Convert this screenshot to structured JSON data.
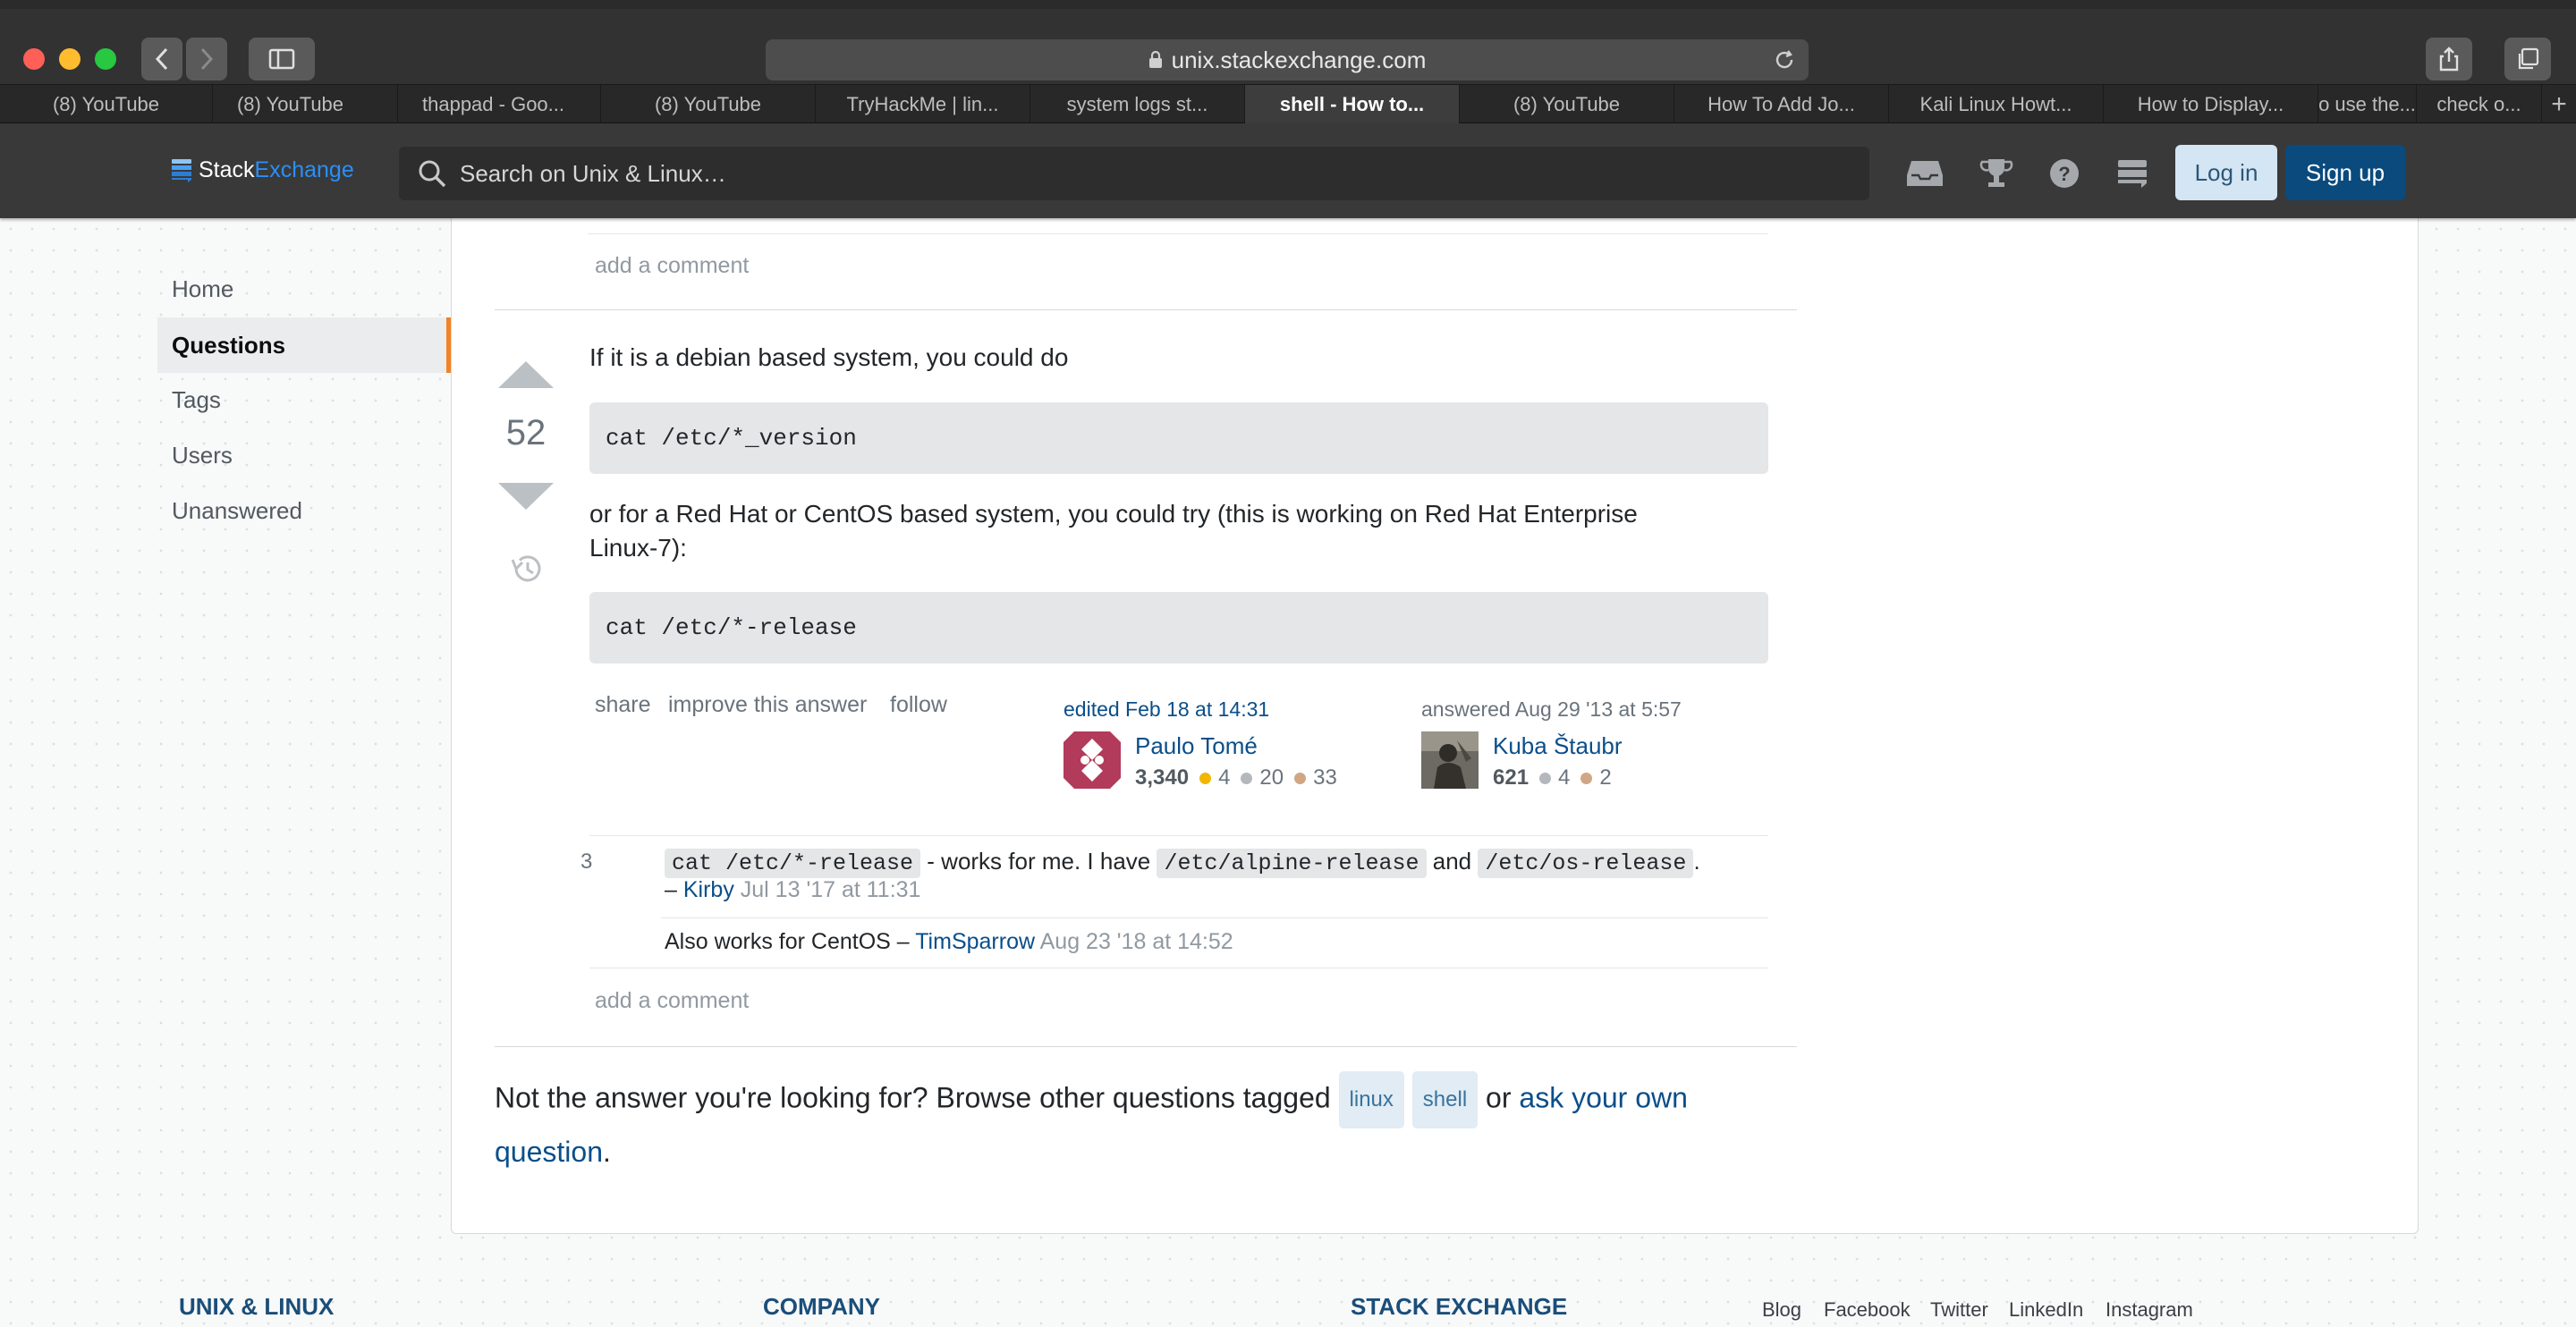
{
  "browser": {
    "url": "unix.stackexchange.com",
    "tabs": [
      "(8) YouTube",
      "(8) YouTube",
      "thappad - Goo...",
      "(8) YouTube",
      "TryHackMe | lin...",
      "system logs st...",
      "shell - How to...",
      "(8) YouTube",
      "How To Add Jo...",
      "Kali Linux Howt...",
      "How to Display...",
      "o use the...",
      "check o..."
    ],
    "active_tab_index": 6,
    "new_tab": "+"
  },
  "header": {
    "logo_stack": "Stack",
    "logo_exchange": "Exchange",
    "search_placeholder": "Search on Unix & Linux…",
    "login": "Log in",
    "signup": "Sign up"
  },
  "sidebar": {
    "items": [
      "Home",
      "Questions",
      "Tags",
      "Users",
      "Unanswered"
    ],
    "selected": "Questions"
  },
  "prev_answer": {
    "add_comment": "add a comment"
  },
  "answer": {
    "votes": "52",
    "intro": "If it is a debian based system, you could do",
    "code1": "cat /etc/*_version",
    "middle_line1": "or for a Red Hat or CentOS based system, you could try (this is working on Red Hat Enterprise",
    "middle_line2": "Linux-7):",
    "code2": "cat /etc/*-release",
    "actions": {
      "share": "share",
      "improve": "improve this answer",
      "follow": "follow"
    },
    "editor": {
      "label": "edited Feb 18 at 14:31",
      "name": "Paulo Tomé",
      "rep": "3,340",
      "gold": "4",
      "silver": "20",
      "bronze": "33"
    },
    "author": {
      "label": "answered Aug 29 '13 at 5:57",
      "name": "Kuba Štaubr",
      "rep": "621",
      "silver": "4",
      "bronze": "2"
    }
  },
  "comments": [
    {
      "score": "3",
      "code_a": "cat /etc/*-release",
      "text_a": "- works for me. I have",
      "code_b": "/etc/alpine-release",
      "text_b": "and",
      "code_c": "/etc/os-release",
      "text_c": ".",
      "dash": "–",
      "user": "Kirby",
      "date": "Jul 13 '17 at 11:31"
    },
    {
      "text": "Also works for CentOS –",
      "user": "TimSparrow",
      "date": "Aug 23 '18 at 14:52"
    }
  ],
  "add_comment": "add a comment",
  "browse": {
    "prefix": "Not the answer you're looking for? Browse other questions tagged",
    "tags": [
      "linux",
      "shell"
    ],
    "or": "or",
    "link1": "ask your own",
    "link2": "question",
    "period": "."
  },
  "footer": {
    "headings": [
      "UNIX & LINUX",
      "COMPANY",
      "STACK EXCHANGE"
    ],
    "links": [
      "Blog",
      "Facebook",
      "Twitter",
      "LinkedIn",
      "Instagram"
    ]
  },
  "colors": {
    "accent": "#0a4a7c",
    "orange_marker": "#f48225",
    "gold": "#f1b600",
    "silver": "#b4b8bc",
    "bronze": "#d1a684"
  }
}
